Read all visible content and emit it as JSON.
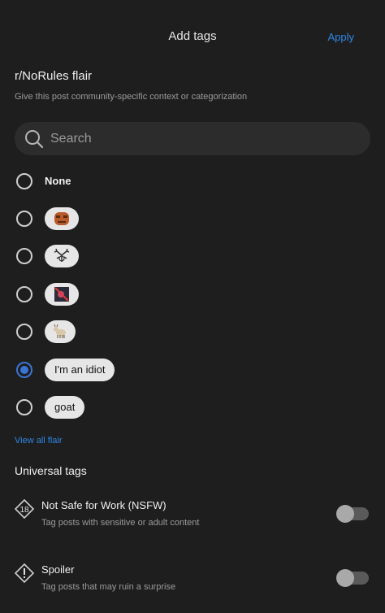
{
  "header": {
    "title": "Add tags",
    "apply_label": "Apply"
  },
  "flair": {
    "title": "r/NoRules flair",
    "subtitle": "Give this post community-specific context or categorization"
  },
  "search": {
    "placeholder": "Search"
  },
  "options": [
    {
      "label": "None",
      "kind": "plain",
      "selected": false
    },
    {
      "label": "",
      "kind": "emoji",
      "icon": "angry-face-emoji-icon",
      "selected": false
    },
    {
      "label": "",
      "kind": "emoji",
      "icon": "deer-antlers-emoji-icon",
      "selected": false
    },
    {
      "label": "",
      "kind": "emoji",
      "icon": "crossed-out-emoji-icon",
      "selected": false
    },
    {
      "label": "",
      "kind": "emoji",
      "icon": "goat-emoji-icon",
      "selected": false
    },
    {
      "label": "I'm an idiot",
      "kind": "text",
      "selected": true
    },
    {
      "label": "goat",
      "kind": "text",
      "selected": false
    }
  ],
  "view_all": "View all flair",
  "universal": {
    "title": "Universal tags",
    "tags": [
      {
        "name": "Not Safe for Work (NSFW)",
        "desc": "Tag posts with sensitive or adult content",
        "icon": "nsfw-18-icon",
        "enabled": false
      },
      {
        "name": "Spoiler",
        "desc": "Tag posts that may ruin a surprise",
        "icon": "spoiler-warning-icon",
        "enabled": false
      }
    ]
  },
  "colors": {
    "background": "#1e1e1e",
    "accent": "#2f86e6",
    "selected": "#3a74d6"
  }
}
